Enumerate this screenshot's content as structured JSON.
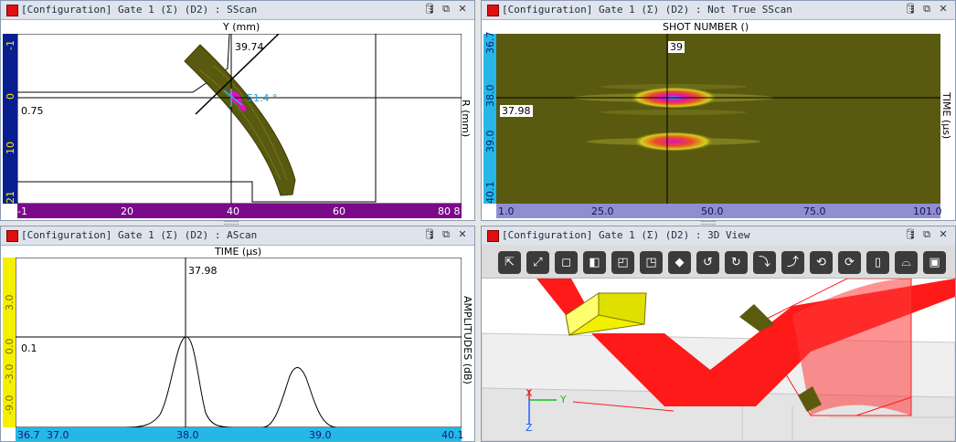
{
  "sscan": {
    "title": "[Configuration] Gate 1 (Σ) (D2) : SScan",
    "top_label": "Y (mm)",
    "right_label": "R (mm)",
    "cursor_value": "39.74",
    "left_value": "0.75",
    "angle_value": "51.4 °",
    "y_ticks": [
      "-1",
      "0",
      "10",
      "21"
    ],
    "x_ticks": [
      "-1",
      "20",
      "40",
      "60",
      "80 8"
    ]
  },
  "true_sscan": {
    "title": "[Configuration] Gate 1 (Σ) (D2) : Not True SScan",
    "top_label": "SHOT NUMBER ()",
    "right_label": "TIME (μs)",
    "cursor_value": "39",
    "left_value": "37.98",
    "y_ticks": [
      "36.7",
      "38.0",
      "39.0",
      "40.1"
    ],
    "x_ticks": [
      "1.0",
      "25.0",
      "50.0",
      "75.0",
      "101.0"
    ]
  },
  "ascan": {
    "title": "[Configuration] Gate 1 (Σ) (D2) : AScan",
    "top_label": "TIME (μs)",
    "right_label": "AMPLITUDES (dB)",
    "cursor_value": "37.98",
    "left_value": "0.1",
    "y_ticks": [
      "3.0",
      "0.0",
      "-3.0",
      "-9.0"
    ],
    "x_ticks": [
      "36.7",
      "37.0",
      "38.0",
      "39.0",
      "40.1"
    ]
  },
  "view3d": {
    "title": "[Configuration] Gate 1 (Σ) (D2) : 3D View",
    "axis_x": "X",
    "axis_y": "Y",
    "axis_z": "Z",
    "tools": [
      "select-tool",
      "fit-tool",
      "cube-front-tool",
      "cube-side-tool",
      "cube-top-tool",
      "cube-iso-tool",
      "cube-solid-tool",
      "rotate-left-tool",
      "rotate-right-tool",
      "rotate-down-tool",
      "rotate-up-tool",
      "rotate-ccw-tool",
      "rotate-cw-tool",
      "slice-tool",
      "probe-tool",
      "box-tool"
    ]
  },
  "titlebar_icons": {
    "db": "🛢",
    "restore": "⧉",
    "close": "✕"
  },
  "colors": {
    "axis_blue": "#0a1f8f",
    "axis_purple": "#7a0a8a",
    "axis_cyan": "#26b7e8",
    "axis_lavender": "#8f8fd0",
    "axis_yellow": "#f4f000",
    "beam_red": "#ff1a1a",
    "wedge_yellow": "#f2f000",
    "olive": "#5b5b10"
  }
}
